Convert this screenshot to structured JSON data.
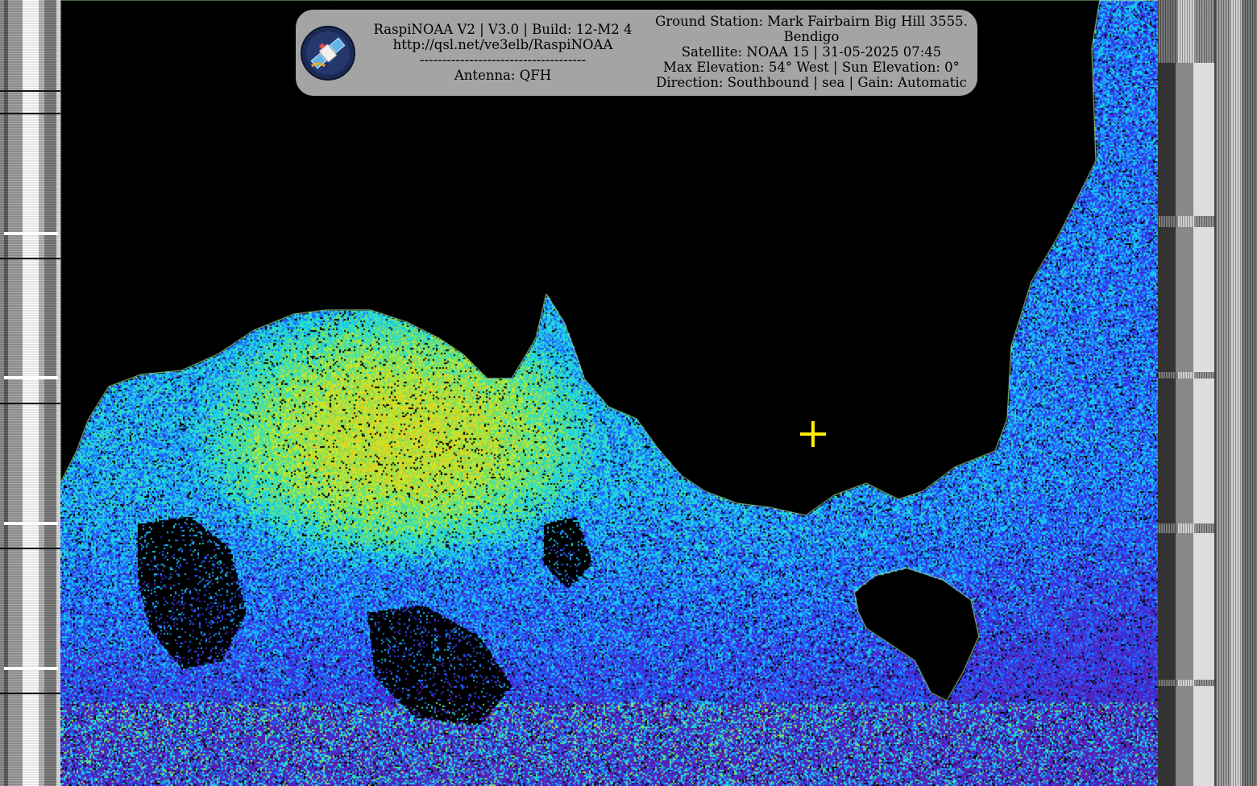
{
  "banner": {
    "left_lines": [
      "RaspiNOAA V2 | V3.0 | Build: 12-M2 4",
      "http://qsl.net/ve3elb/RaspiNOAA",
      "-------------------------------------",
      "Antenna: QFH"
    ],
    "right_lines": [
      "Ground Station: Mark Fairbairn Big Hill 3555.",
      "Bendigo",
      "Satellite: NOAA 15 | 31-05-2025 07:45",
      "Max Elevation: 54° West | Sun Elevation: 0°",
      "Direction: Southbound | sea | Gain: Automatic"
    ],
    "logo_icon": "satellite-icon"
  },
  "overlay": {
    "marker_icon": "crosshair-icon",
    "marker_color": "#ffee00"
  },
  "colors": {
    "background": "#000000",
    "banner": "#a4a4a4",
    "palette": [
      "#5a1fb0",
      "#3a2ee0",
      "#1f6bff",
      "#18c8f0",
      "#30e0c0",
      "#78e060",
      "#c0e830",
      "#e0d020",
      "#ff5010"
    ]
  }
}
